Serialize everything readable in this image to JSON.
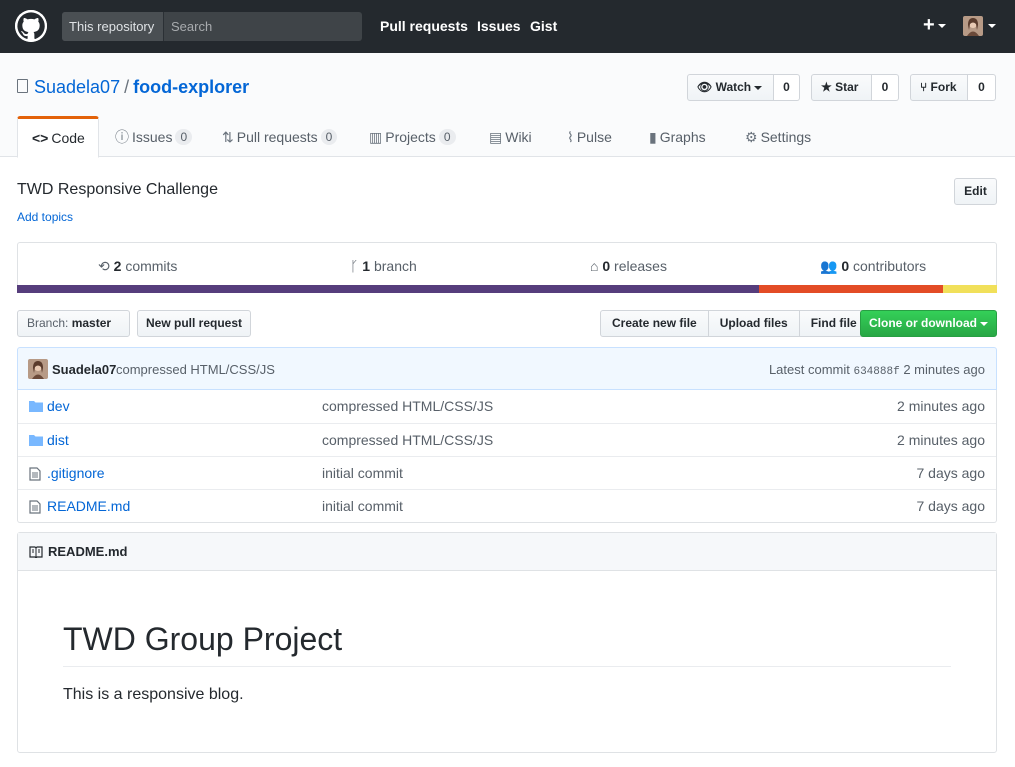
{
  "header": {
    "scope_label": "This repository",
    "search_placeholder": "Search",
    "nav": [
      "Pull requests",
      "Issues",
      "Gist"
    ]
  },
  "repo": {
    "owner": "Suadela07",
    "separator": "/",
    "name": "food-explorer",
    "watch_label": "Watch",
    "watch_count": "0",
    "star_label": "Star",
    "star_count": "0",
    "fork_label": "Fork",
    "fork_count": "0"
  },
  "tabs": [
    {
      "label": "Code",
      "count": null,
      "icon": "code-icon"
    },
    {
      "label": "Issues",
      "count": "0",
      "icon": "issue-icon"
    },
    {
      "label": "Pull requests",
      "count": "0",
      "icon": "pull-request-icon"
    },
    {
      "label": "Projects",
      "count": "0",
      "icon": "project-icon"
    },
    {
      "label": "Wiki",
      "count": null,
      "icon": "wiki-icon"
    },
    {
      "label": "Pulse",
      "count": null,
      "icon": "pulse-icon"
    },
    {
      "label": "Graphs",
      "count": null,
      "icon": "graph-icon"
    },
    {
      "label": "Settings",
      "count": null,
      "icon": "gear-icon"
    }
  ],
  "description": {
    "text": "TWD Responsive Challenge",
    "add_topics": "Add topics",
    "edit_label": "Edit"
  },
  "summary": {
    "commits_num": "2",
    "commits_label": "commits",
    "branch_num": "1",
    "branch_label": "branch",
    "releases_num": "0",
    "releases_label": "releases",
    "contributors_num": "0",
    "contributors_label": "contributors"
  },
  "language_bar": [
    {
      "color": "#563d7c",
      "percent": 75.7
    },
    {
      "color": "#e34c26",
      "percent": 18.8
    },
    {
      "color": "#f1e05a",
      "percent": 5.5
    }
  ],
  "file_nav": {
    "branch_prefix": "Branch:",
    "branch_name": "master",
    "new_pr": "New pull request",
    "create_file": "Create new file",
    "upload_files": "Upload files",
    "find_file": "Find file",
    "clone": "Clone or download"
  },
  "commit": {
    "author": "Suadela07",
    "message": "compressed HTML/CSS/JS",
    "latest_label": "Latest commit",
    "sha": "634888f",
    "age": "2 minutes ago"
  },
  "files": [
    {
      "name": "dev",
      "type": "folder",
      "message": "compressed HTML/CSS/JS",
      "age": "2 minutes ago"
    },
    {
      "name": "dist",
      "type": "folder",
      "message": "compressed HTML/CSS/JS",
      "age": "2 minutes ago"
    },
    {
      "name": ".gitignore",
      "type": "file",
      "message": "initial commit",
      "age": "7 days ago"
    },
    {
      "name": "README.md",
      "type": "file",
      "message": "initial commit",
      "age": "7 days ago"
    }
  ],
  "readme": {
    "file_label": "README.md",
    "heading": "TWD Group Project",
    "body": "This is a responsive blog."
  }
}
